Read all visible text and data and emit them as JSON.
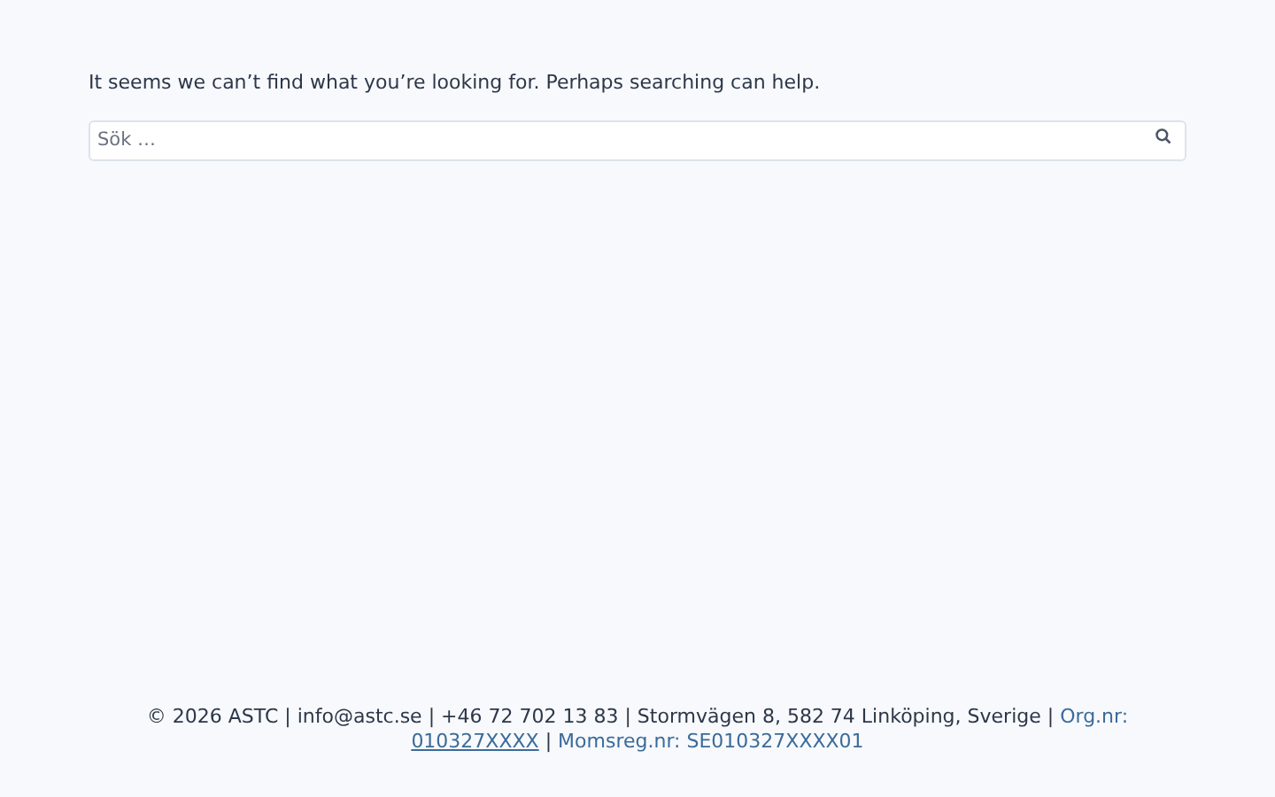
{
  "message": "It seems we can’t find what you’re looking for. Perhaps searching can help.",
  "search": {
    "placeholder": "Sök …"
  },
  "footer": {
    "text": "© 2026 ASTC | info@astc.se | +46 72 702 13 83 | Stormvägen 8, 582 74 Linköping, Sverige | ",
    "org_label": "Org.nr: ",
    "org_link": "010327XXXX",
    "separator": " | ",
    "vat": "Momsreg.nr: SE010327XXXX01"
  }
}
